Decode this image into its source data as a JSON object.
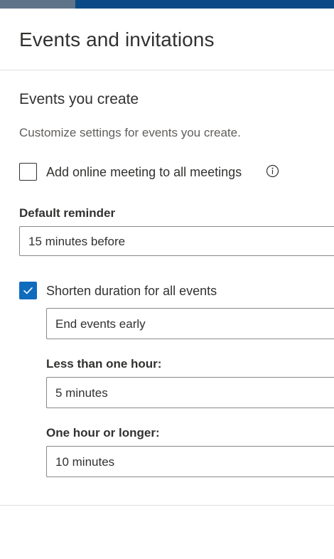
{
  "header": {
    "title": "Events and invitations"
  },
  "events_section": {
    "title": "Events you create",
    "description": "Customize settings for events you create.",
    "online_meeting": {
      "label": "Add online meeting to all meetings",
      "checked": false
    },
    "default_reminder": {
      "label": "Default reminder",
      "value": "15 minutes before"
    },
    "shorten_duration": {
      "label": "Shorten duration for all events",
      "checked": true
    },
    "shorten_mode": {
      "value": "End events early"
    },
    "less_than_hour": {
      "label": "Less than one hour:",
      "value": "5 minutes"
    },
    "hour_or_longer": {
      "label": "One hour or longer:",
      "value": "10 minutes"
    }
  },
  "colors": {
    "accent": "#0f6cbd",
    "topbar": "#0b4a86"
  },
  "icons": {
    "info": "info-icon",
    "check": "checkmark-icon"
  }
}
